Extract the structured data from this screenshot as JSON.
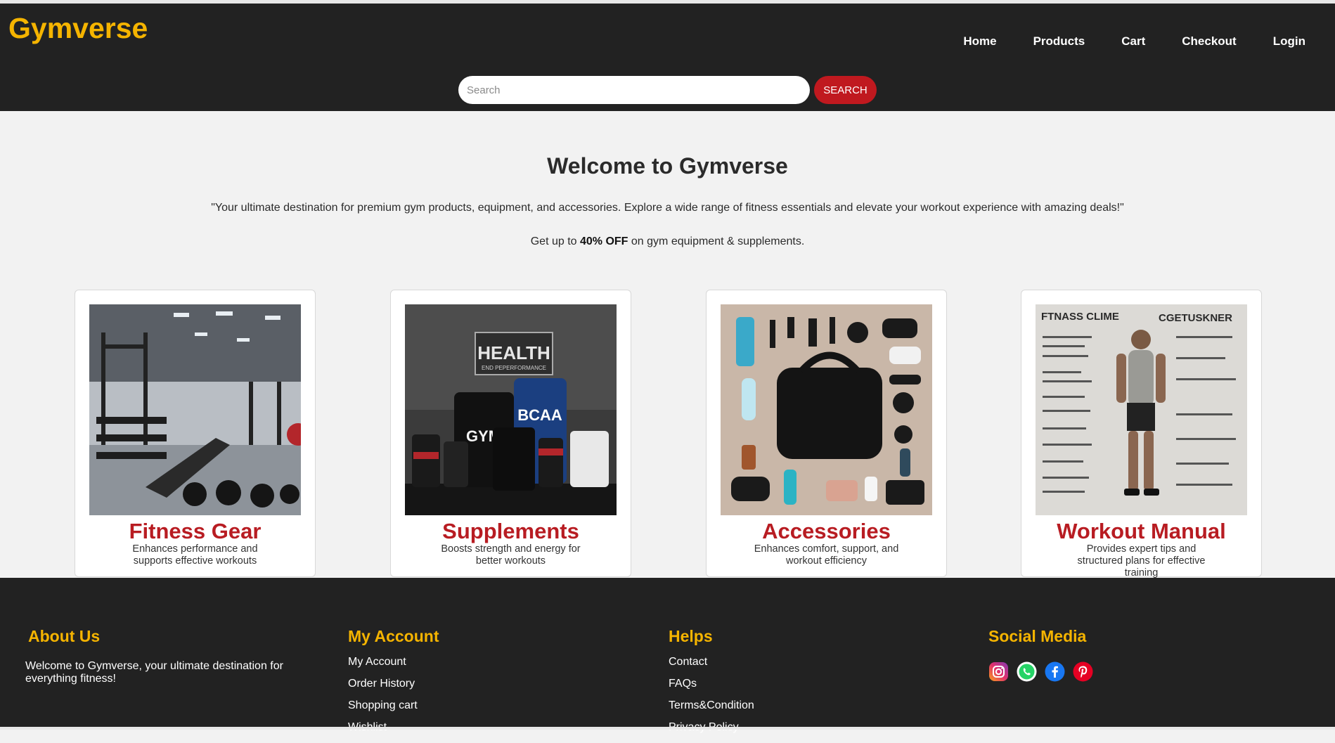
{
  "header": {
    "logo": "Gymverse",
    "nav": [
      "Home",
      "Products",
      "Cart",
      "Checkout",
      "Login"
    ],
    "search_placeholder": "Search",
    "search_button": "SEARCH"
  },
  "hero": {
    "title": "Welcome to Gymverse",
    "tagline": "\"Your ultimate destination for premium gym products, equipment, and accessories. Explore a wide range of fitness essentials and elevate your workout experience with amazing deals!\"",
    "promo_prefix": "Get up to ",
    "promo_bold": "40% OFF",
    "promo_suffix": " on gym equipment & supplements."
  },
  "cards": [
    {
      "title": "Fitness Gear",
      "desc": "Enhances performance and supports effective workouts"
    },
    {
      "title": "Supplements",
      "desc": "Boosts strength and energy for better workouts"
    },
    {
      "title": "Accessories",
      "desc": "Enhances comfort, support, and workout efficiency"
    },
    {
      "title": "Workout Manual",
      "desc": "Provides expert tips and structured plans for effective training"
    }
  ],
  "card_image_text": {
    "supplements_sign": "HEALTH",
    "supplements_sub": "END PEPERFORMANCE",
    "gym_powder": "GYM",
    "bcaa": "BCAA",
    "manual_left": "FTNASS CLIME",
    "manual_right": "CGETUSKNER"
  },
  "footer": {
    "about_title": "About Us",
    "about_text": "Welcome to Gymverse, your ultimate destination for everything fitness!",
    "account_title": "My Account",
    "account_links": [
      "My Account",
      "Order History",
      "Shopping cart",
      "Wishlist"
    ],
    "help_title": "Helps",
    "help_links": [
      "Contact",
      "FAQs",
      "Terms&Condition",
      "Privacy Policy"
    ],
    "social_title": "Social Media",
    "social_icons": [
      "instagram-icon",
      "whatsapp-icon",
      "facebook-icon",
      "pinterest-icon"
    ]
  },
  "colors": {
    "accent_yellow": "#f5b400",
    "accent_red": "#c0191f",
    "header_bg": "#222222"
  }
}
